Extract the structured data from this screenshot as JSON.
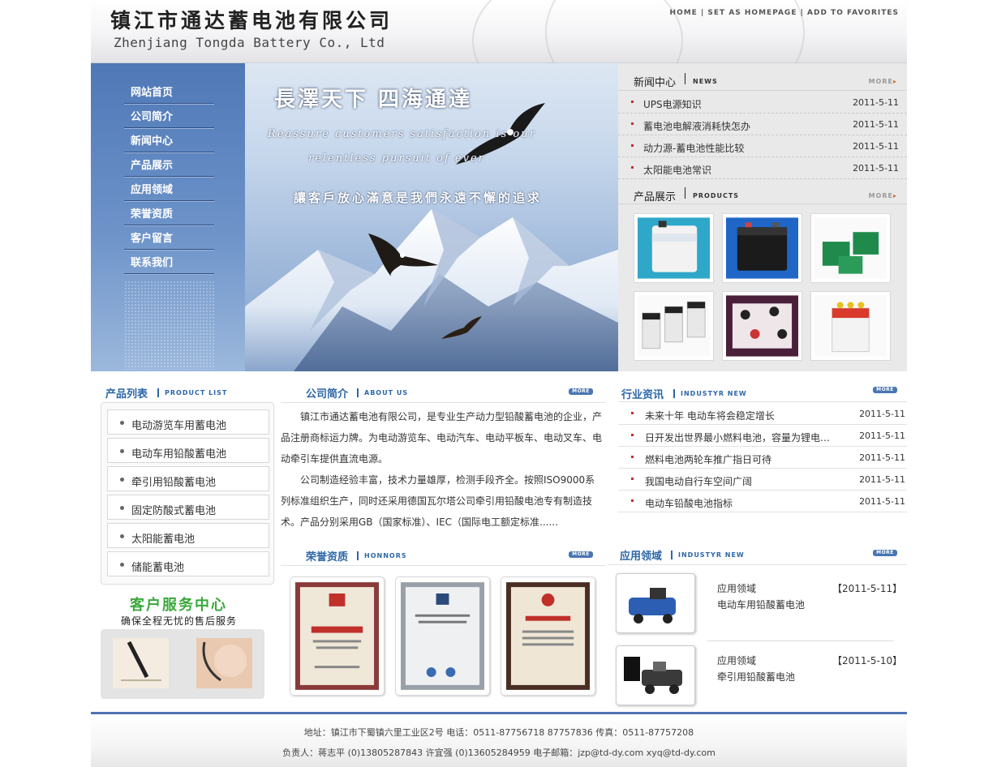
{
  "header": {
    "logo_cn": "镇江市通达蓄电池有限公司",
    "logo_en": "Zhenjiang Tongda Battery Co., Ltd",
    "links": [
      "HOME",
      "SET AS HOMEPAGE",
      "ADD TO FAVORITES"
    ],
    "link_sep": "|"
  },
  "nav": {
    "items": [
      "网站首页",
      "公司简介",
      "新闻中心",
      "产品展示",
      "应用领域",
      "荣誉资质",
      "客户留言",
      "联系我们"
    ]
  },
  "hero": {
    "title": "長澤天下  四海通達",
    "en_line1": "Reassure customers satisfaction is our",
    "en_line2": "relentless pursuit of ever",
    "slogan": "讓客戶放心滿意是我們永遠不懈的追求"
  },
  "news_center": {
    "title_cn": "新闻中心",
    "title_en": "NEWS",
    "more": "MORE",
    "items": [
      {
        "title": "UPS电源知识",
        "date": "2011-5-11"
      },
      {
        "title": "蓄电池电解液消耗快怎办",
        "date": "2011-5-11"
      },
      {
        "title": "动力源-蓄电池性能比较",
        "date": "2011-5-11"
      },
      {
        "title": "太阳能电池常识",
        "date": "2011-5-11"
      }
    ]
  },
  "products_show": {
    "title_cn": "产品展示",
    "title_en": "PRODUCTS",
    "more": "MORE"
  },
  "product_list": {
    "title_cn": "产品列表",
    "title_en": "PRODUCT LIST",
    "items": [
      "电动游览车用蓄电池",
      "电动车用铅酸蓄电池",
      "牵引用铅酸蓄电池",
      "固定防酸式蓄电池",
      "太阳能蓄电池",
      "储能蓄电池"
    ]
  },
  "service": {
    "title": "客户服务中心",
    "subtitle": "确保全程无忧的售后服务"
  },
  "about": {
    "title_cn": "公司简介",
    "title_en": "ABOUT US",
    "more": "MORE",
    "para1": "镇江市通达蓄电池有限公司，是专业生产动力型铅酸蓄电池的企业，产品注册商标运力牌。为电动游览车、电动汽车、电动平板车、电动叉车、电动牵引车提供直流电源。",
    "para2": "公司制造经验丰富，技术力量雄厚，检测手段齐全。按照ISO9000系列标准组织生产，同时还采用德国瓦尔塔公司牵引用铅酸电池专有制造技术。产品分别采用GB（国家标准）、IEC（国际电工额定标准......"
  },
  "industry": {
    "title_cn": "行业资讯",
    "title_en": "INDUSTYR NEW",
    "more": "MORE",
    "items": [
      {
        "title": "未来十年 电动车将会稳定增长",
        "date": "2011-5-11"
      },
      {
        "title": "日开发出世界最小燃料电池，容量为锂电…",
        "date": "2011-5-11"
      },
      {
        "title": "燃料电池两轮车推广指日可待",
        "date": "2011-5-11"
      },
      {
        "title": "我国电动自行车空间广阔",
        "date": "2011-5-11"
      },
      {
        "title": "电动车铅酸电池指标",
        "date": "2011-5-11"
      }
    ]
  },
  "honors": {
    "title_cn": "荣誉资质",
    "title_en": "HONNORS",
    "more": "MORE"
  },
  "application": {
    "title_cn": "应用领域",
    "title_en": "INDUSTYR NEW",
    "more": "MORE",
    "items": [
      {
        "category": "应用领域",
        "date": "【2011-5-11】",
        "name": "电动车用铅酸蓄电池"
      },
      {
        "category": "应用领域",
        "date": "【2011-5-10】",
        "name": "牵引用铅酸蓄电池"
      }
    ]
  },
  "footer": {
    "line1": "地址：镇江市下蜀镇六里工业区2号   电话：0511-87756718  87757836    传真：0511-87757208",
    "line2": "负责人：蒋志平 (0)13805287843  许宜强 (0)13605284959  电子邮箱：jzp@td-dy.com    xyq@td-dy.com"
  }
}
